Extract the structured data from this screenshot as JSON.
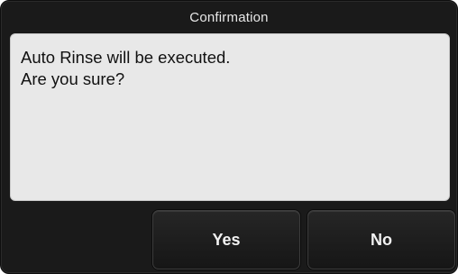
{
  "dialog": {
    "title": "Confirmation",
    "message_lines": [
      "Auto Rinse will be executed.",
      "Are you sure?"
    ],
    "buttons": {
      "yes_label": "Yes",
      "no_label": "No"
    }
  },
  "colors": {
    "dialog_background": "#1a1a1a",
    "message_panel_background": "#e8e8e8",
    "button_background": "#1c1c1c",
    "title_text": "#e8e8e8",
    "message_text": "#111111"
  }
}
